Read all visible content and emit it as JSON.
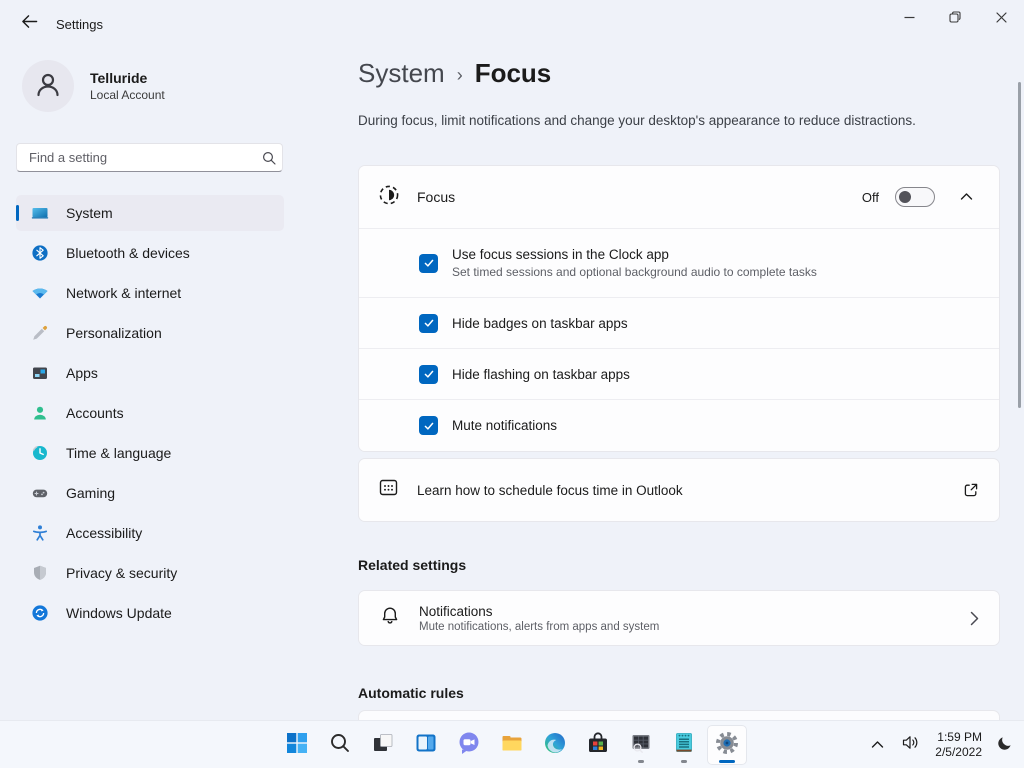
{
  "titlebar": {
    "title": "Settings"
  },
  "sidebar": {
    "user": {
      "name": "Telluride",
      "account_type": "Local Account"
    },
    "search": {
      "placeholder": "Find a setting",
      "icon": "search-icon"
    },
    "items": [
      {
        "label": "System",
        "icon": "system-icon",
        "selected": true
      },
      {
        "label": "Bluetooth & devices",
        "icon": "bluetooth-icon",
        "selected": false
      },
      {
        "label": "Network & internet",
        "icon": "network-icon",
        "selected": false
      },
      {
        "label": "Personalization",
        "icon": "personalization-icon",
        "selected": false
      },
      {
        "label": "Apps",
        "icon": "apps-icon",
        "selected": false
      },
      {
        "label": "Accounts",
        "icon": "accounts-icon",
        "selected": false
      },
      {
        "label": "Time & language",
        "icon": "time-language-icon",
        "selected": false
      },
      {
        "label": "Gaming",
        "icon": "gaming-icon",
        "selected": false
      },
      {
        "label": "Accessibility",
        "icon": "accessibility-icon",
        "selected": false
      },
      {
        "label": "Privacy & security",
        "icon": "privacy-security-icon",
        "selected": false
      },
      {
        "label": "Windows Update",
        "icon": "windows-update-icon",
        "selected": false
      }
    ]
  },
  "main": {
    "breadcrumb": {
      "parent": "System",
      "separator": "›",
      "current": "Focus"
    },
    "description": "During focus, limit notifications and change your desktop's appearance to reduce distractions.",
    "focus_card": {
      "title": "Focus",
      "icon": "focus-icon",
      "state_label": "Off",
      "toggle_state": "off",
      "expanded": true,
      "options": [
        {
          "label": "Use focus sessions in the Clock app",
          "description": "Set timed sessions and optional background audio to complete tasks",
          "checked": true
        },
        {
          "label": "Hide badges on taskbar apps",
          "checked": true
        },
        {
          "label": "Hide flashing on taskbar apps",
          "checked": true
        },
        {
          "label": "Mute notifications",
          "checked": true
        }
      ]
    },
    "outlook_card": {
      "label": "Learn how to schedule focus time in Outlook",
      "icon": "calendar-icon",
      "action_icon": "external-link-icon"
    },
    "related_settings": {
      "heading": "Related settings",
      "items": [
        {
          "title": "Notifications",
          "description": "Mute notifications, alerts from apps and system",
          "icon": "bell-icon",
          "action_icon": "chevron-right-icon"
        }
      ]
    },
    "automatic_rules": {
      "heading": "Automatic rules"
    }
  },
  "taskbar": {
    "pinned": [
      {
        "icon": "start-icon"
      },
      {
        "icon": "search-icon"
      },
      {
        "icon": "task-view-icon"
      },
      {
        "icon": "widgets-icon"
      },
      {
        "icon": "chat-icon"
      },
      {
        "icon": "file-explorer-icon"
      },
      {
        "icon": "edge-icon"
      },
      {
        "icon": "store-icon"
      },
      {
        "icon": "log-viewer-app-icon",
        "running": true
      },
      {
        "icon": "notepad-app-icon",
        "running": true
      },
      {
        "icon": "settings-gear-icon",
        "running": true,
        "active": true
      }
    ],
    "tray": {
      "expand_icon": "chevron-up-icon",
      "volume_icon": "volume-icon",
      "time": "1:59 PM",
      "date": "2/5/2022",
      "focus_icon": "moon-icon"
    }
  },
  "colors": {
    "accent": "#0067C0",
    "background": "#EFF2F9",
    "card": "#FDFDFE"
  }
}
